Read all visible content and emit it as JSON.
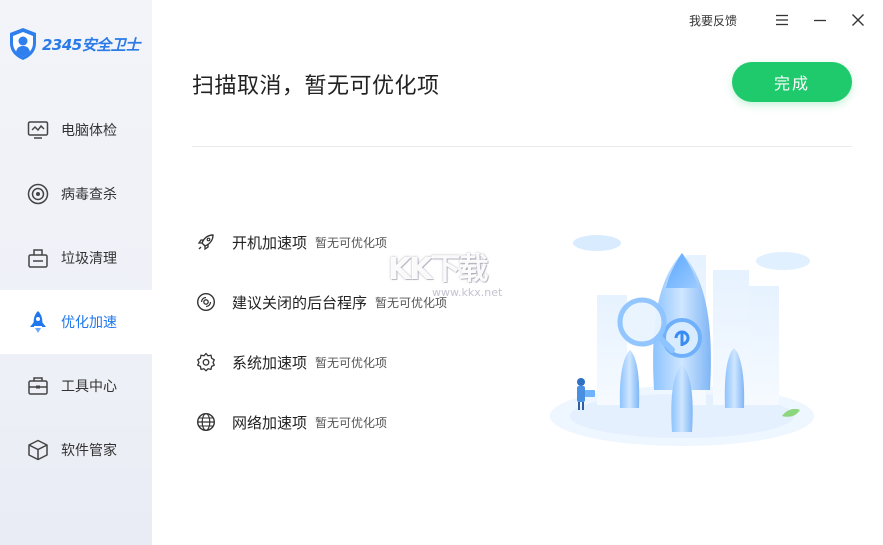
{
  "app": {
    "logo_text": "2345安全卫士"
  },
  "titlebar": {
    "feedback_label": "我要反馈"
  },
  "sidebar": {
    "items": [
      {
        "label": "电脑体检",
        "icon": "monitor-icon"
      },
      {
        "label": "病毒查杀",
        "icon": "target-icon"
      },
      {
        "label": "垃圾清理",
        "icon": "trash-box-icon"
      },
      {
        "label": "优化加速",
        "icon": "rocket-icon",
        "active": true
      },
      {
        "label": "工具中心",
        "icon": "toolbox-icon"
      },
      {
        "label": "软件管家",
        "icon": "cube-icon"
      }
    ]
  },
  "main": {
    "headline": "扫描取消，暂无可优化项",
    "done_label": "完成",
    "items": [
      {
        "name": "开机加速项",
        "status": "暂无可优化项",
        "icon": "rocket-outline-icon"
      },
      {
        "name": "建议关闭的后台程序",
        "status": "暂无可优化项",
        "icon": "disc-icon"
      },
      {
        "name": "系统加速项",
        "status": "暂无可优化项",
        "icon": "gear-icon"
      },
      {
        "name": "网络加速项",
        "status": "暂无可优化项",
        "icon": "globe-icon"
      }
    ]
  },
  "watermark": {
    "big": "KK下载",
    "small": "www.kkx.net"
  },
  "colors": {
    "accent": "#1f78f0",
    "done_button": "#1fca6c",
    "sidebar_bg": "#eef0f7"
  }
}
